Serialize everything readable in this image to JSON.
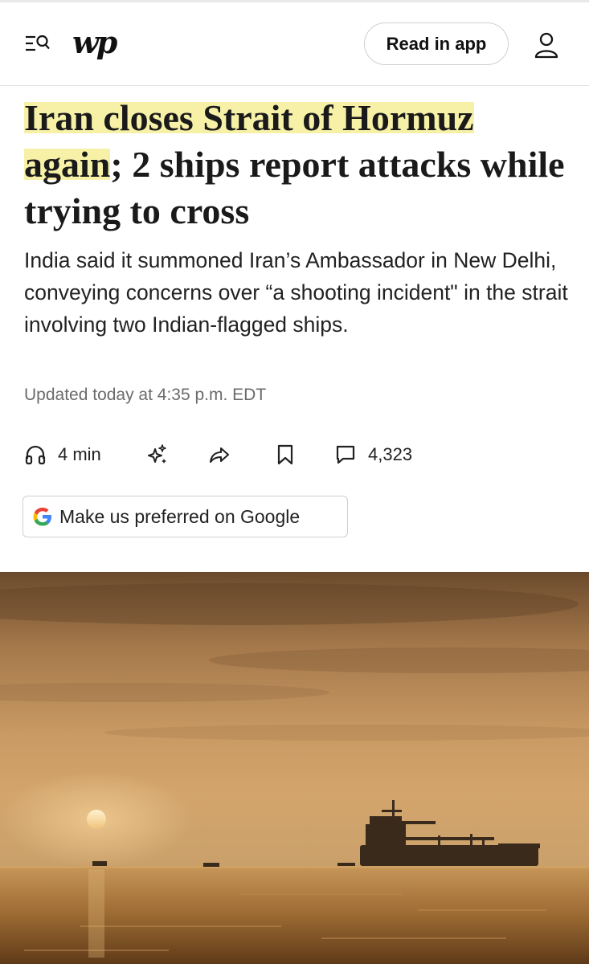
{
  "header": {
    "logo_text": "wp",
    "read_in_app_label": "Read in app",
    "icons": {
      "menu": "menu-search-icon",
      "account": "user-icon"
    }
  },
  "article": {
    "headline_highlighted": "Iran closes Strait of Hormuz again",
    "headline_rest": "; 2 ships report attacks while trying to cross",
    "dek": "India said it summoned Iran’s Ambassador in New Delhi, conveying concerns over “a shooting incident\" in the strait involving two Indian-flagged ships.",
    "timestamp": "Updated today at 4:35 p.m. EDT",
    "highlight_color": "#f7f1a8"
  },
  "actions": {
    "listen": {
      "icon": "headphones-icon",
      "label": "4 min"
    },
    "gift": {
      "icon": "sparkle-icon"
    },
    "share": {
      "icon": "share-arrow-icon"
    },
    "save": {
      "icon": "bookmark-icon"
    },
    "comments": {
      "icon": "comment-icon",
      "count": "4,323"
    }
  },
  "google_preferred": {
    "icon": "google-g-icon",
    "label": "Make us preferred on Google"
  },
  "hero_image": {
    "subject": "tanker ship on ocean at sunset"
  }
}
